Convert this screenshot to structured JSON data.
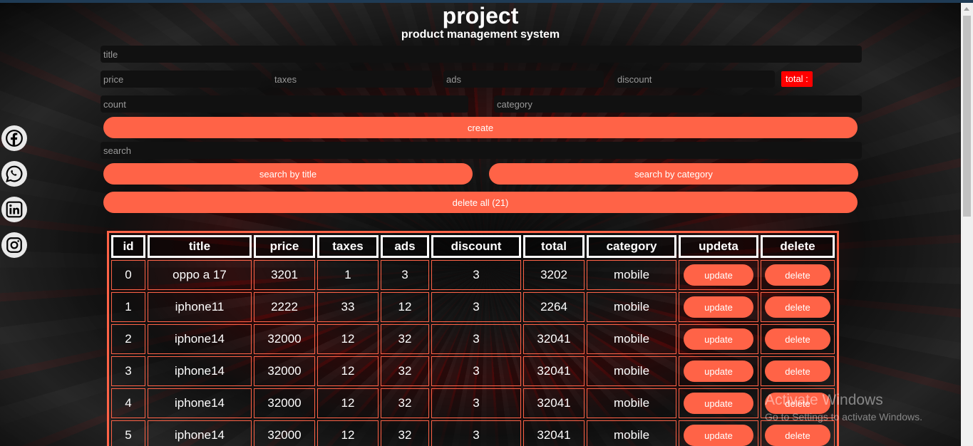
{
  "header": {
    "title": "project",
    "subtitle": "product management system"
  },
  "form": {
    "title_placeholder": "title",
    "price_placeholder": "price",
    "taxes_placeholder": "taxes",
    "ads_placeholder": "ads",
    "discount_placeholder": "discount",
    "total_label": "total :",
    "count_placeholder": "count",
    "category_placeholder": "category",
    "create_label": "create",
    "search_placeholder": "search",
    "search_title_label": "search by title",
    "search_category_label": "search by category",
    "delete_all_label": "delete all (21)"
  },
  "social": [
    {
      "name": "facebook-icon"
    },
    {
      "name": "whatsapp-icon"
    },
    {
      "name": "linkedin-icon"
    },
    {
      "name": "instagram-icon"
    }
  ],
  "table": {
    "headers": [
      "id",
      "title",
      "price",
      "taxes",
      "ads",
      "discount",
      "total",
      "category",
      "updeta",
      "delete"
    ],
    "update_label": "update",
    "delete_label": "delete",
    "rows": [
      [
        "0",
        "oppo a 17",
        "3201",
        "1",
        "3",
        "3",
        "3202",
        "mobile"
      ],
      [
        "1",
        "iphone11",
        "2222",
        "33",
        "12",
        "3",
        "2264",
        "mobile"
      ],
      [
        "2",
        "iphone14",
        "32000",
        "12",
        "32",
        "3",
        "32041",
        "mobile"
      ],
      [
        "3",
        "iphone14",
        "32000",
        "12",
        "32",
        "3",
        "32041",
        "mobile"
      ],
      [
        "4",
        "iphone14",
        "32000",
        "12",
        "32",
        "3",
        "32041",
        "mobile"
      ],
      [
        "5",
        "iphone14",
        "32000",
        "12",
        "32",
        "3",
        "32041",
        "mobile"
      ]
    ]
  },
  "watermark": {
    "line1": "Activate Windows",
    "line2": "Go to Settings to activate Windows."
  },
  "colors": {
    "accent": "#ff6347",
    "total_bg": "#ff0000"
  }
}
